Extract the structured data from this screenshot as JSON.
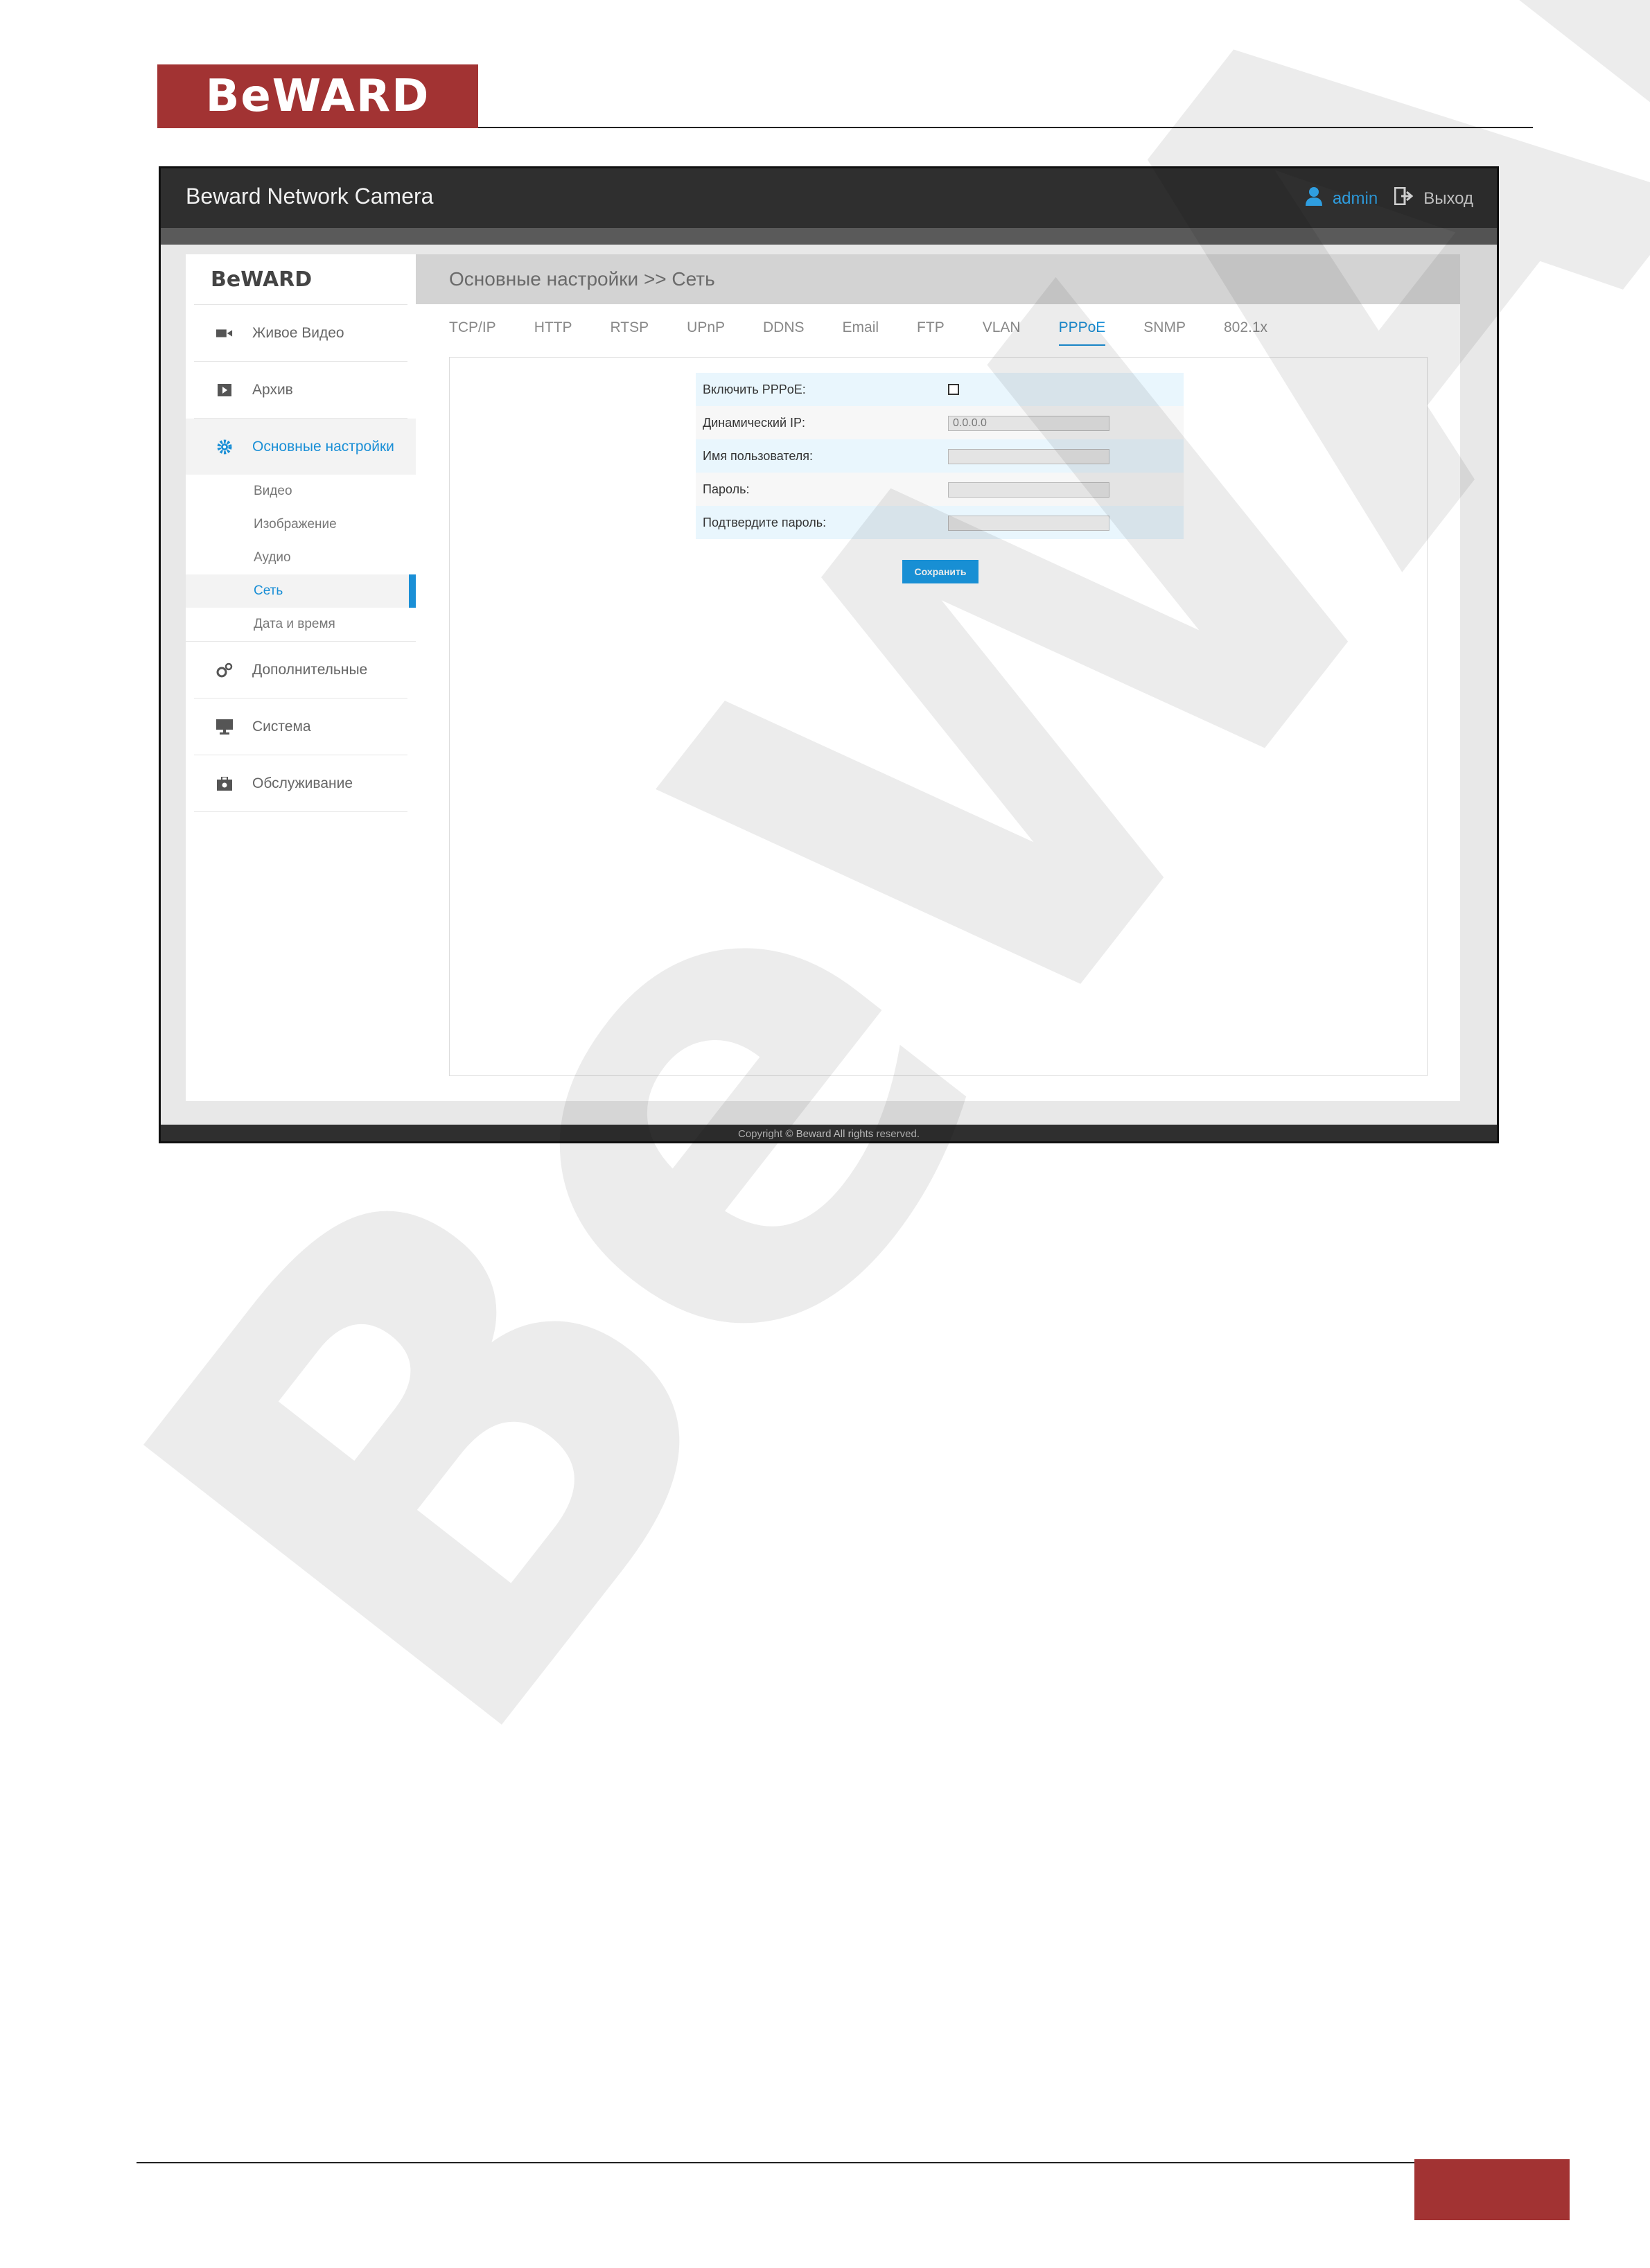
{
  "document": {
    "logo_text": "BeWARD"
  },
  "app": {
    "title": "Beward Network Camera",
    "user": "admin",
    "logout": "Выход",
    "side_logo": "BeWARD"
  },
  "sidebar": {
    "items": [
      {
        "label": "Живое Видео",
        "icon": "video-camera-icon"
      },
      {
        "label": "Архив",
        "icon": "play-icon"
      },
      {
        "label": "Основные настройки",
        "icon": "gear-icon"
      }
    ],
    "sub_items": [
      {
        "label": "Видео"
      },
      {
        "label": "Изображение"
      },
      {
        "label": "Аудио"
      },
      {
        "label": "Сеть"
      },
      {
        "label": "Дата и время"
      }
    ],
    "lower_items": [
      {
        "label": "Дополнительные",
        "icon": "gears-icon"
      },
      {
        "label": "Система",
        "icon": "monitor-icon"
      },
      {
        "label": "Обслуживание",
        "icon": "toolbox-icon"
      }
    ]
  },
  "content": {
    "breadcrumb": "Основные настройки >> Сеть",
    "tabs": [
      "TCP/IP",
      "HTTP",
      "RTSP",
      "UPnP",
      "DDNS",
      "Email",
      "FTP",
      "VLAN",
      "PPPoE",
      "SNMP",
      "802.1x"
    ],
    "active_tab": "PPPoE"
  },
  "form": {
    "enable_label": "Включить PPPoE:",
    "enable_checked": false,
    "dynamic_ip_label": "Динамический IP:",
    "dynamic_ip_value": "0.0.0.0",
    "username_label": "Имя пользователя:",
    "username_value": "",
    "password_label": "Пароль:",
    "password_value": "",
    "confirm_label": "Подтвердите пароль:",
    "confirm_value": "",
    "save_label": "Сохранить"
  },
  "footer": {
    "copyright": "Copyright © Beward All rights reserved."
  },
  "colors": {
    "brand_red": "#a23333",
    "accent_blue": "#1a8fd6"
  }
}
